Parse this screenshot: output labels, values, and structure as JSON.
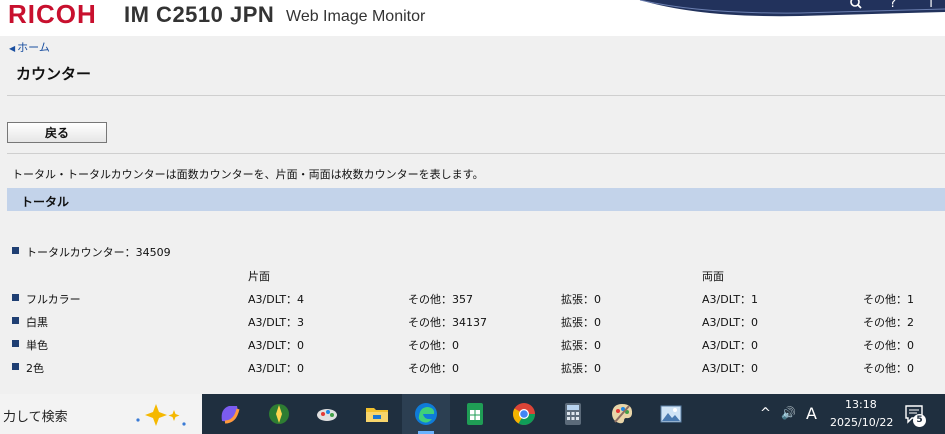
{
  "header": {
    "brand": "RICOH",
    "model": "IM C2510 JPN",
    "product": "Web Image Monitor",
    "search_icon_char": "🔍",
    "help_icon_char": "?",
    "info_icon_char": "i"
  },
  "nav": {
    "home_link": "ホーム"
  },
  "page": {
    "title": "カウンター",
    "back_button": "戻る"
  },
  "section": {
    "title": "トータル",
    "description": "トータル・トータルカウンターは面数カウンターを、片面・両面は枚数カウンターを表します。",
    "total_label": "トータルカウンター：34509",
    "col_simplex": "片面",
    "col_duplex": "両面",
    "rows": [
      {
        "label": "フルカラー",
        "s_a3": "A3/DLT：4",
        "s_other": "その他：357",
        "s_ext": "拡張：0",
        "d_a3": "A3/DLT：1",
        "d_other": "その他：1"
      },
      {
        "label": "白黒",
        "s_a3": "A3/DLT：3",
        "s_other": "その他：34137",
        "s_ext": "拡張：0",
        "d_a3": "A3/DLT：0",
        "d_other": "その他：2"
      },
      {
        "label": "単色",
        "s_a3": "A3/DLT：0",
        "s_other": "その他：0",
        "s_ext": "拡張：0",
        "d_a3": "A3/DLT：0",
        "d_other": "その他：0"
      },
      {
        "label": "2色",
        "s_a3": "A3/DLT：0",
        "s_other": "その他：0",
        "s_ext": "拡張：0",
        "d_a3": "A3/DLT：0",
        "d_other": "その他：0"
      }
    ]
  },
  "taskbar": {
    "search_text": "力して検索",
    "tray_input_indicator": "A",
    "tray_volume": "🔊",
    "time": "13:18",
    "date": "2025/10/22",
    "notification_count": "5"
  },
  "colors": {
    "brand_red": "#c8102e",
    "section_bar": "#c3d3ea",
    "bullet": "#1f3f73",
    "taskbar": "#1f2f3f",
    "link": "#1a4fa0"
  }
}
